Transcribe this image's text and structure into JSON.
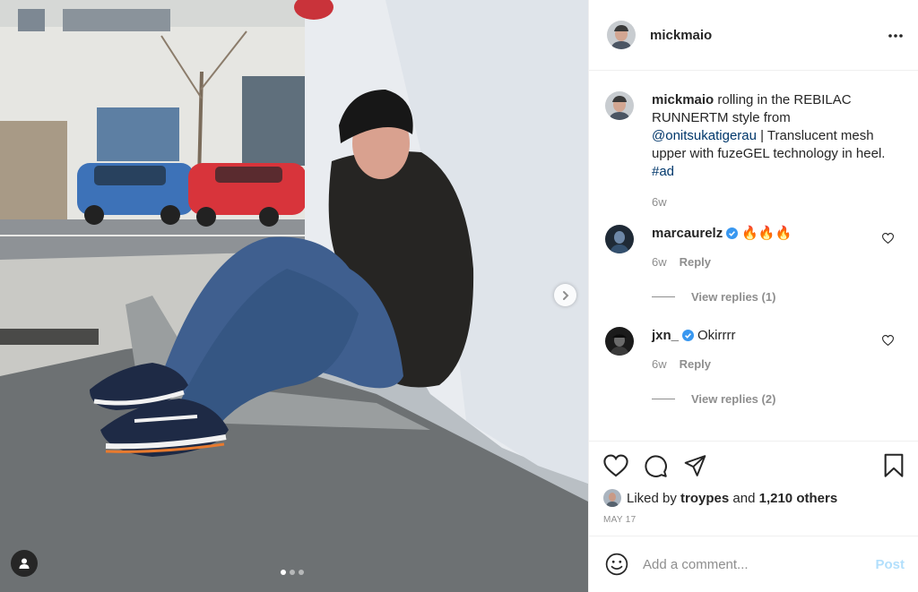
{
  "post": {
    "author": "mickmaio",
    "caption_text": "rolling in the REBILAC RUNNERTM style from",
    "caption_mention": "@onitsukatigerau",
    "caption_rest": "| Translucent mesh upper with fuzeGEL technology in heel.",
    "caption_hashtag": "#ad",
    "caption_time": "6w",
    "photo_icons": [
      "chevron-right-icon",
      "user-tag-icon"
    ],
    "carousel_index": 1,
    "carousel_count": 3
  },
  "comments": [
    {
      "user": "marcaurelz",
      "verified": true,
      "text": "🔥🔥🔥",
      "time": "6w",
      "reply_label": "Reply",
      "view_replies": "View replies (1)"
    },
    {
      "user": "jxn_",
      "verified": true,
      "text": "Okirrrr",
      "time": "6w",
      "reply_label": "Reply",
      "view_replies": "View replies (2)"
    }
  ],
  "likes": {
    "prefix": "Liked by",
    "user": "troypes",
    "middle": "and",
    "others": "1,210 others"
  },
  "date": "MAY 17",
  "add_comment": {
    "placeholder": "Add a comment...",
    "post_label": "Post"
  },
  "icons": [
    "more-options-icon",
    "heart-icon",
    "comment-icon",
    "share-icon",
    "bookmark-icon",
    "emoji-icon",
    "verified-icon"
  ],
  "colors": {
    "link": "#00376b",
    "verified": "#3897f0",
    "post_disabled": "#b2dffc",
    "muted": "#8e8e8e",
    "text": "#262626"
  }
}
